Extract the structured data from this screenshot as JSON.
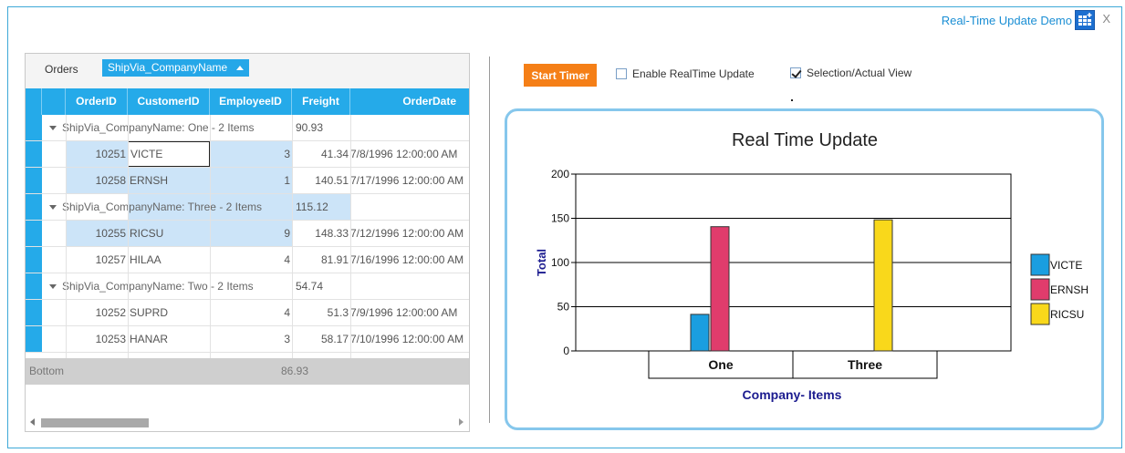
{
  "window": {
    "title": "Real-Time Update Demo",
    "close_label": "X",
    "grid_icon": "grid-plus-icon"
  },
  "grid": {
    "group_panel": {
      "table": "Orders",
      "chip": "ShipVia_CompanyName"
    },
    "columns": [
      "OrderID",
      "CustomerID",
      "EmployeeID",
      "Freight",
      "OrderDate"
    ],
    "groups": [
      {
        "label": "ShipVia_CompanyName: One - 2 Items",
        "sum": "90.93",
        "rows": [
          {
            "order_id": "10251",
            "customer_id": "VICTE",
            "employee_id": "3",
            "freight": "41.34",
            "order_date": "7/8/1996 12:00:00 AM"
          },
          {
            "order_id": "10258",
            "customer_id": "ERNSH",
            "employee_id": "1",
            "freight": "140.51",
            "order_date": "7/17/1996 12:00:00 AM"
          }
        ]
      },
      {
        "label": "ShipVia_CompanyName: Three - 2 Items",
        "sum": "115.12",
        "rows": [
          {
            "order_id": "10255",
            "customer_id": "RICSU",
            "employee_id": "9",
            "freight": "148.33",
            "order_date": "7/12/1996 12:00:00 AM"
          },
          {
            "order_id": "10257",
            "customer_id": "HILAA",
            "employee_id": "4",
            "freight": "81.91",
            "order_date": "7/16/1996 12:00:00 AM"
          }
        ]
      },
      {
        "label": "ShipVia_CompanyName: Two - 2 Items",
        "sum": "54.74",
        "rows": [
          {
            "order_id": "10252",
            "customer_id": "SUPRD",
            "employee_id": "4",
            "freight": "51.3",
            "order_date": "7/9/1996 12:00:00 AM"
          },
          {
            "order_id": "10253",
            "customer_id": "HANAR",
            "employee_id": "3",
            "freight": "58.17",
            "order_date": "7/10/1996 12:00:00 AM"
          }
        ]
      }
    ],
    "footer": {
      "label": "Bottom",
      "value": "86.93"
    }
  },
  "controls": {
    "start_timer": "Start Timer",
    "realtime_label": "Enable RealTime Update",
    "realtime_checked": false,
    "selection_label": "Selection/Actual View",
    "selection_checked": true
  },
  "chart_data": {
    "type": "bar",
    "title": "Real Time Update",
    "xlabel": "Company- Items",
    "ylabel": "Total",
    "categories": [
      "One",
      "Three"
    ],
    "ylim": [
      0,
      200
    ],
    "yticks": [
      0,
      50,
      100,
      150,
      200
    ],
    "grid": true,
    "legend_position": "right",
    "series": [
      {
        "name": "VICTE",
        "color": "#1a9ee0",
        "values": [
          41.34,
          null
        ]
      },
      {
        "name": "ERNSH",
        "color": "#e03c6c",
        "values": [
          140.51,
          null
        ]
      },
      {
        "name": "RICSU",
        "color": "#f9d81b",
        "values": [
          null,
          148.33
        ]
      }
    ]
  }
}
